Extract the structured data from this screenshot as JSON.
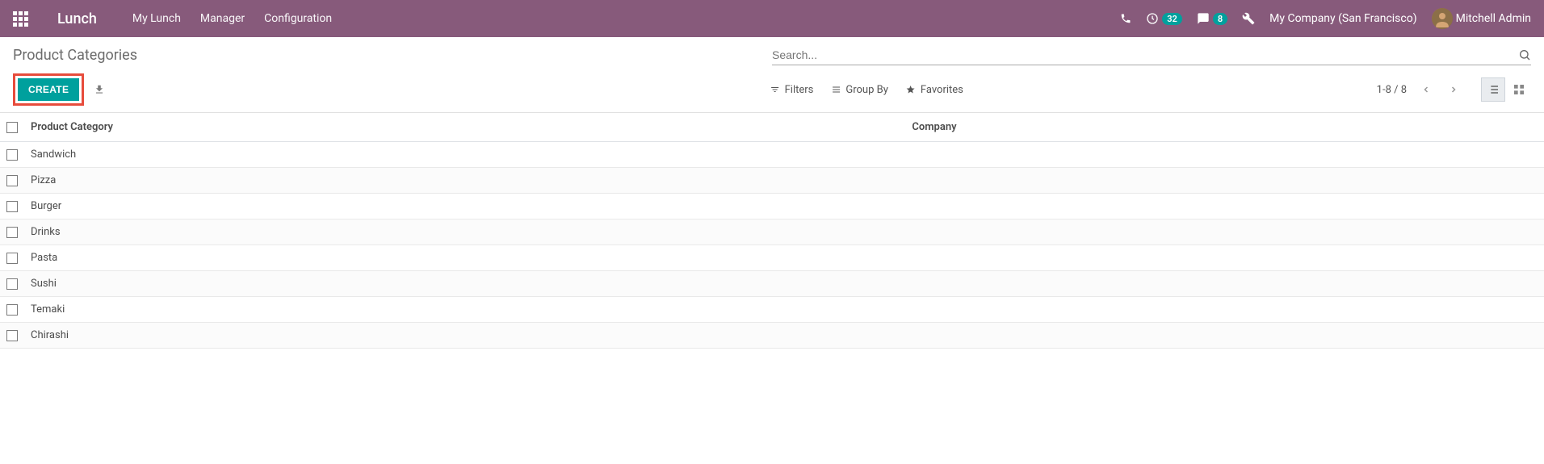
{
  "header": {
    "brand": "Lunch",
    "menu": [
      "My Lunch",
      "Manager",
      "Configuration"
    ],
    "clock_badge": "32",
    "chat_badge": "8",
    "company": "My Company (San Francisco)",
    "username": "Mitchell Admin"
  },
  "page": {
    "breadcrumb": "Product Categories",
    "search_placeholder": "Search...",
    "create_label": "Create",
    "download_label": "Download",
    "filters_label": "Filters",
    "groupby_label": "Group By",
    "favorites_label": "Favorites",
    "pager": "1-8 / 8"
  },
  "table": {
    "col_category": "Product Category",
    "col_company": "Company",
    "rows": [
      {
        "name": "Sandwich",
        "company": ""
      },
      {
        "name": "Pizza",
        "company": ""
      },
      {
        "name": "Burger",
        "company": ""
      },
      {
        "name": "Drinks",
        "company": ""
      },
      {
        "name": "Pasta",
        "company": ""
      },
      {
        "name": "Sushi",
        "company": ""
      },
      {
        "name": "Temaki",
        "company": ""
      },
      {
        "name": "Chirashi",
        "company": ""
      }
    ]
  }
}
